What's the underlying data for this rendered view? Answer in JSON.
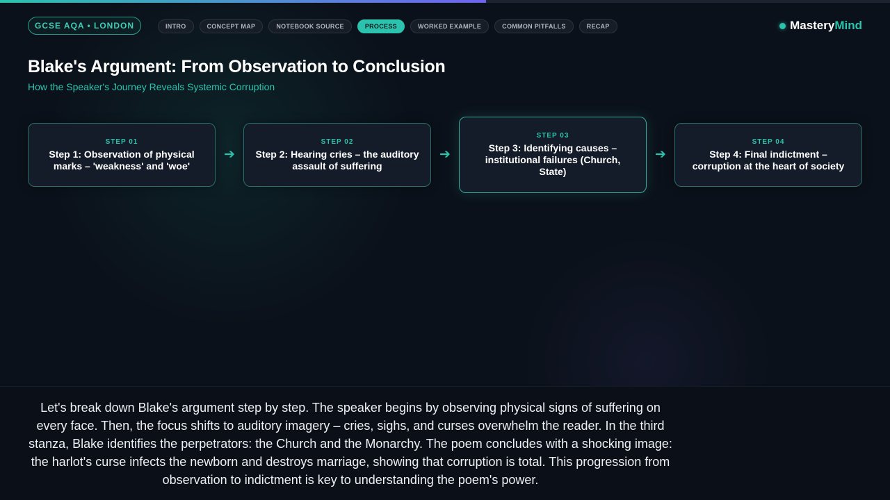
{
  "progress": {
    "percent": 54.6
  },
  "header": {
    "course_badge": "GCSE AQA • LONDON",
    "nav_tabs": [
      {
        "label": "INTRO",
        "active": false
      },
      {
        "label": "CONCEPT MAP",
        "active": false
      },
      {
        "label": "NOTEBOOK SOURCE",
        "active": false
      },
      {
        "label": "PROCESS",
        "active": true
      },
      {
        "label": "WORKED EXAMPLE",
        "active": false
      },
      {
        "label": "COMMON PITFALLS",
        "active": false
      },
      {
        "label": "RECAP",
        "active": false
      }
    ],
    "brand": {
      "part1": "Mastery",
      "part2": "Mind"
    }
  },
  "slide": {
    "title": "Blake's Argument: From Observation to Conclusion",
    "subtitle": "How the Speaker's Journey Reveals Systemic Corruption",
    "steps": [
      {
        "number": "STEP 01",
        "text": "Step 1: Observation of physical marks – 'weakness' and 'woe'"
      },
      {
        "number": "STEP 02",
        "text": "Step 2: Hearing cries – the auditory assault of suffering"
      },
      {
        "number": "STEP 03",
        "text": "Step 3: Identifying causes – institutional failures (Church, State)"
      },
      {
        "number": "STEP 04",
        "text": "Step 4: Final indictment – corruption at the heart of society"
      }
    ],
    "arrow_glyph": "➔"
  },
  "caption": {
    "text": "Let's break down Blake's argument step by step. The speaker begins by observing physical signs of suffering on every face. Then, the focus shifts to auditory imagery – cries, sighs, and curses overwhelm the reader. In the third stanza, Blake identifies the perpetrators: the Church and the Monarchy. The poem concludes with a shocking image: the harlot's curse infects the newborn and destroys marriage, showing that corruption is total. This progression from observation to indictment is key to understanding the poem's power."
  },
  "colors": {
    "accent": "#2bc3ad",
    "background": "#0b111a",
    "progress_end": "#6f63f0"
  }
}
